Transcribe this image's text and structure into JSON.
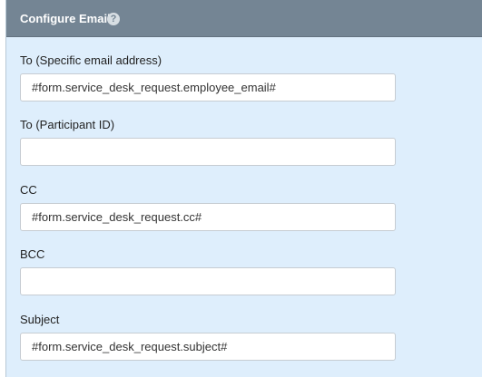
{
  "panel": {
    "title": "Configure Email",
    "help_glyph": "?",
    "help_icon": "question-circle-icon"
  },
  "fields": {
    "to_email": {
      "label": "To (Specific email address)",
      "value": "#form.service_desk_request.employee_email#"
    },
    "to_participant": {
      "label": "To (Participant ID)",
      "value": ""
    },
    "cc": {
      "label": "CC",
      "value": "#form.service_desk_request.cc#"
    },
    "bcc": {
      "label": "BCC",
      "value": ""
    },
    "subject": {
      "label": "Subject",
      "value": "#form.service_desk_request.subject#"
    }
  },
  "colors": {
    "header_bg": "#748594",
    "panel_bg": "#deeefc",
    "input_border": "#c6ccd2"
  }
}
